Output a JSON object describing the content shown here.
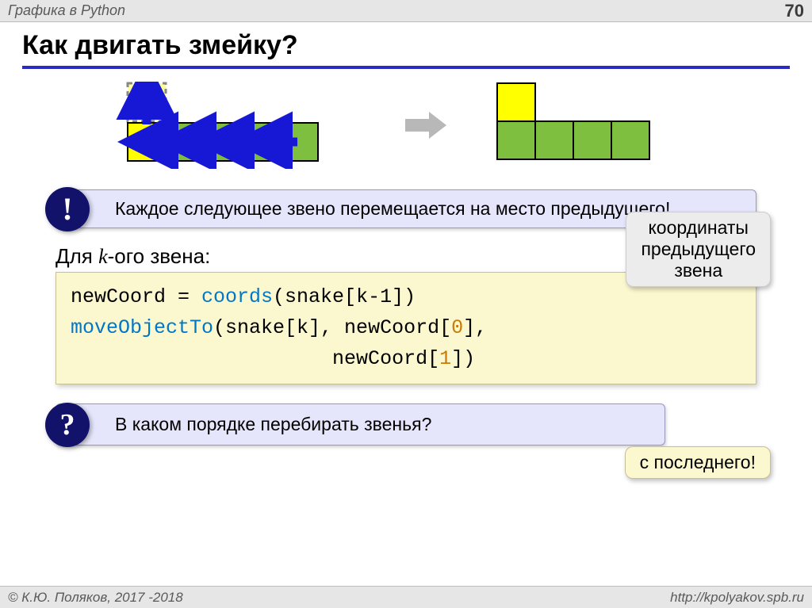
{
  "header": {
    "topic": "Графика в Python",
    "page": "70"
  },
  "title": "Как двигать змейку?",
  "callout1": "Каждое следующее звено перемещается на место предыдущего!",
  "badge1": "!",
  "subhead_prefix": "Для ",
  "subhead_var": "k",
  "subhead_suffix": "-ого звена:",
  "note1_line1": "координаты",
  "note1_line2": "предыдущего",
  "note1_line3": "звена",
  "code": {
    "l1a": "newCoord = ",
    "l1fn": "coords",
    "l1b": "(snake[k-1])",
    "l2fn": "moveObjectTo",
    "l2a": "(snake[k], newCoord[",
    "l2n0": "0",
    "l2b": "],",
    "l3a": "                      newCoord[",
    "l3n1": "1",
    "l3b": "])"
  },
  "badge2": "?",
  "callout2": "В каком порядке перебирать звенья?",
  "note2": "с последнего!",
  "footer": {
    "left": "© К.Ю. Поляков, 2017 -2018",
    "right": "http://kpolyakov.spb.ru"
  }
}
